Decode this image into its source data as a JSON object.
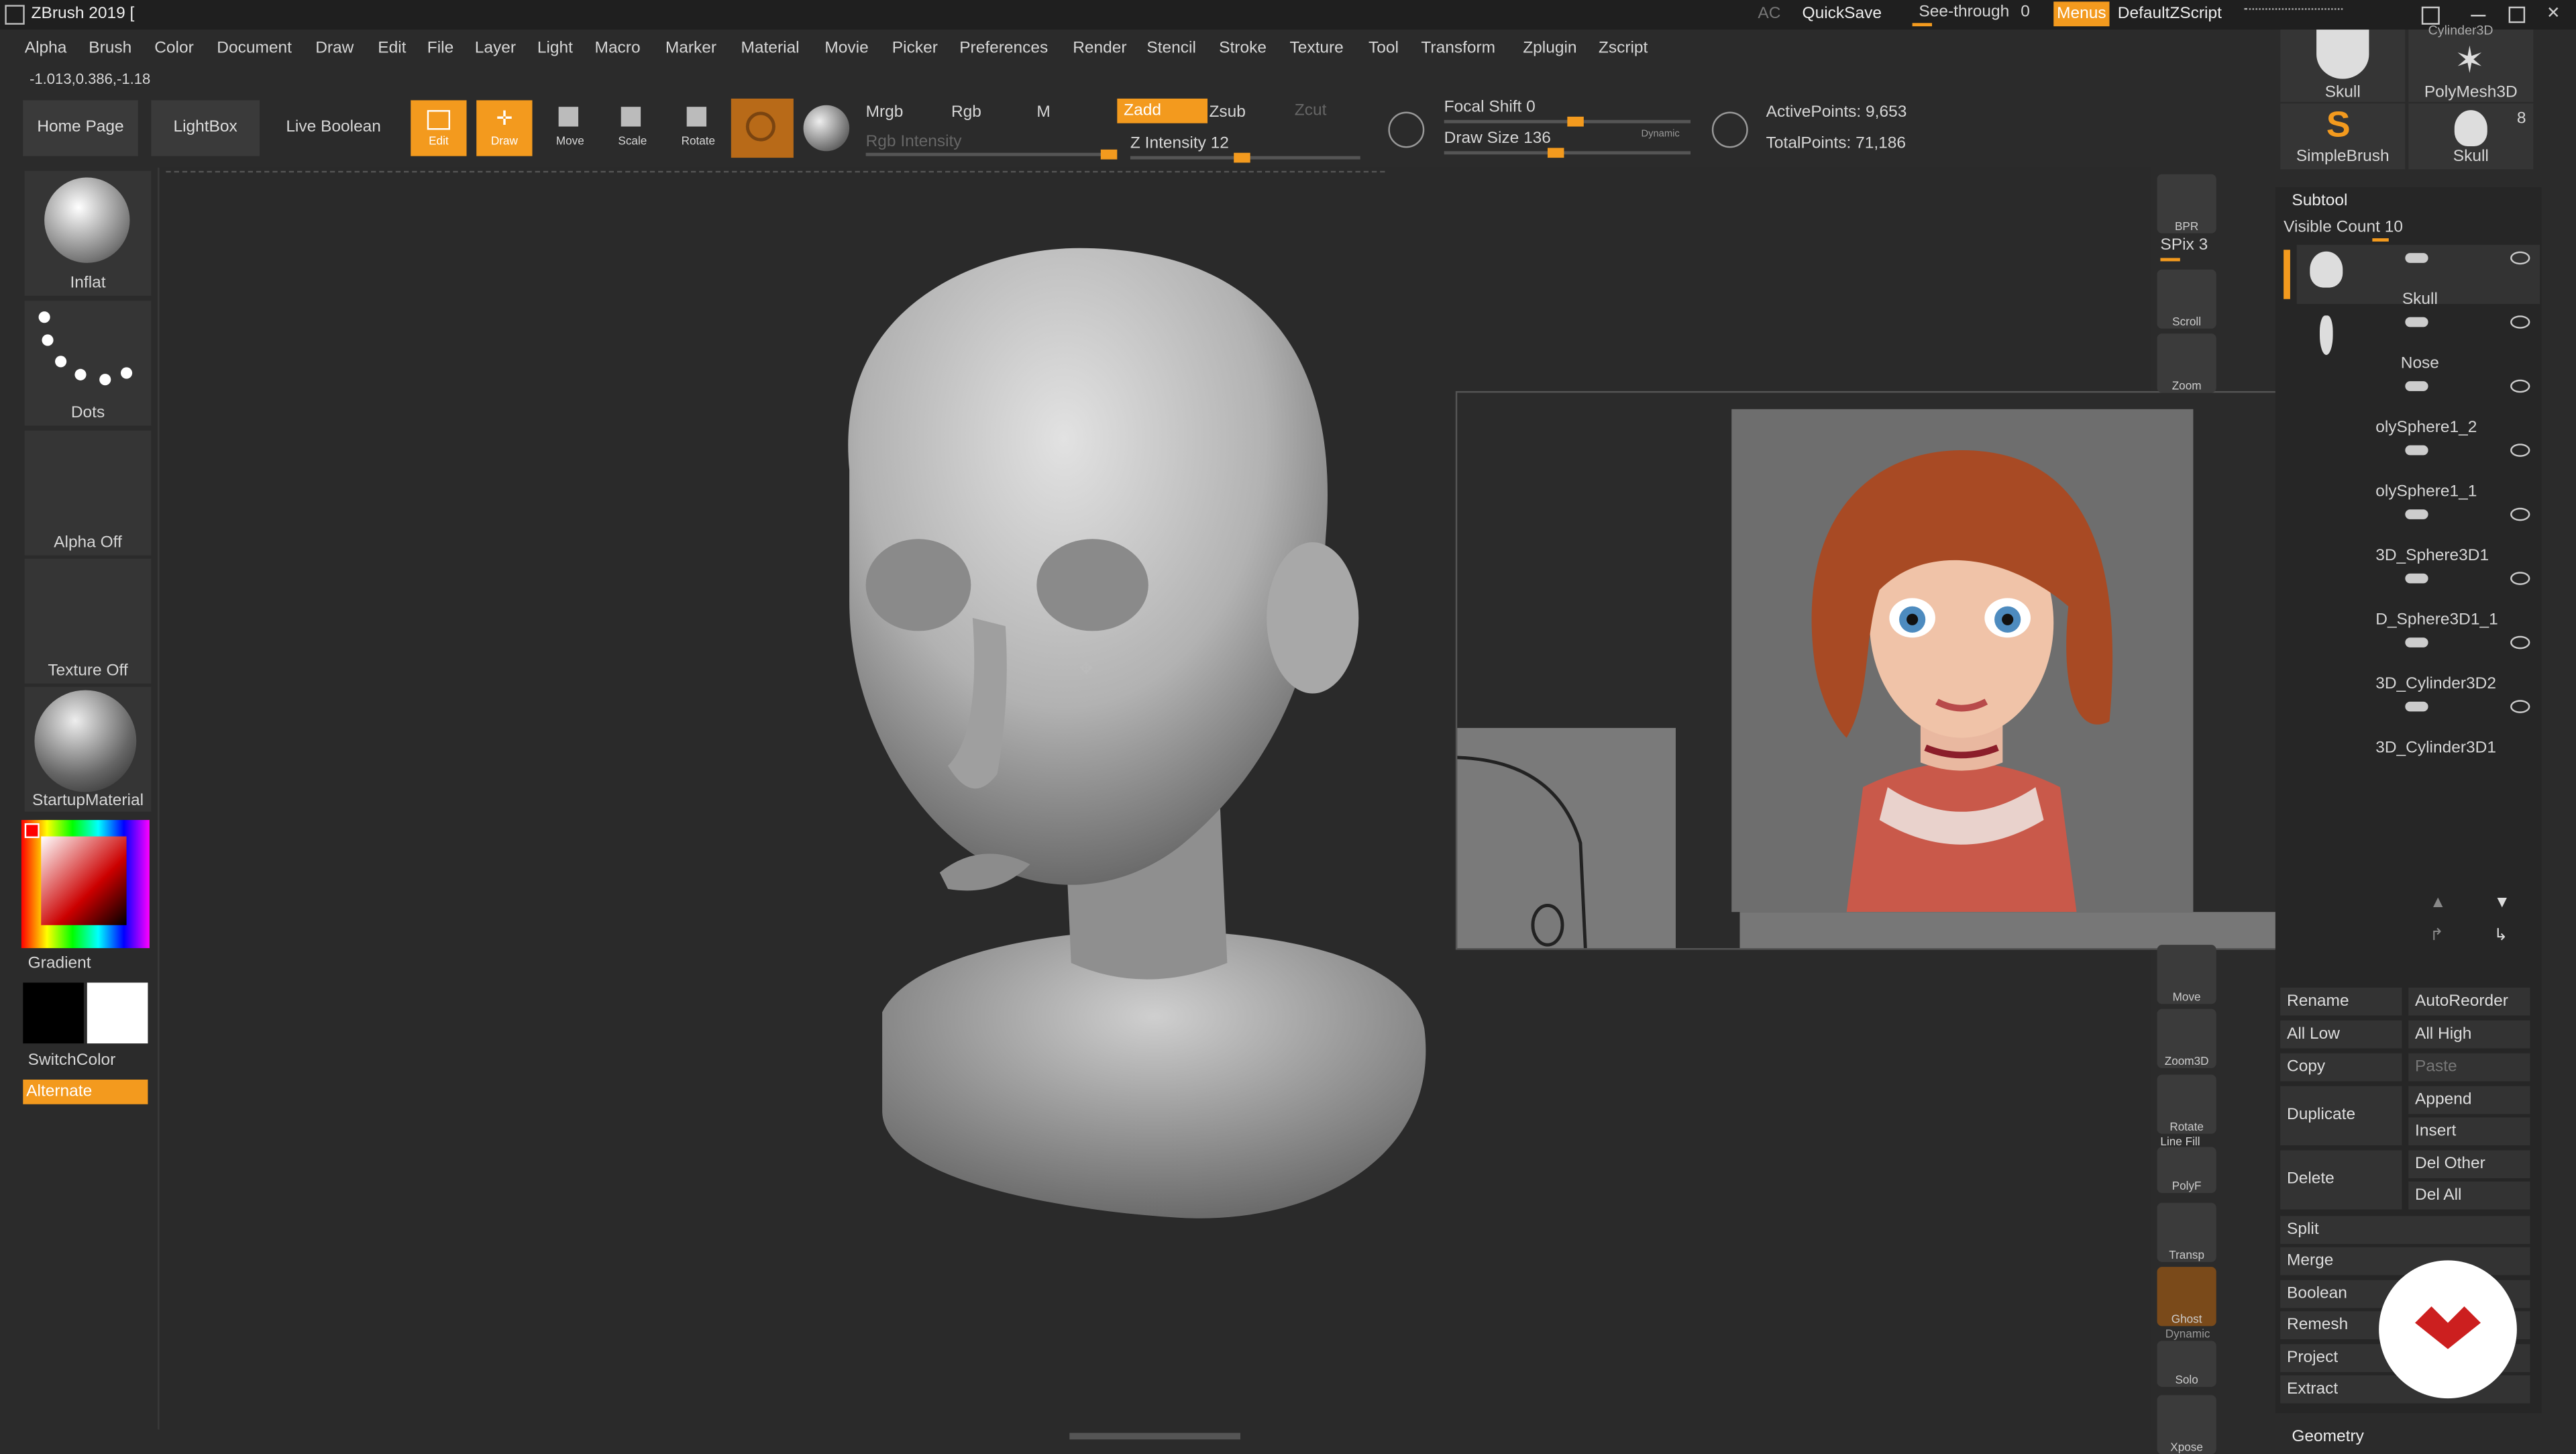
{
  "window": {
    "title": "ZBrush 2019 [",
    "ac": "AC",
    "quicksave": "QuickSave",
    "see_through_label": "See-through",
    "see_through_value": "0",
    "menus": "Menus",
    "script": "DefaultZScript"
  },
  "menubar": [
    "Alpha",
    "Brush",
    "Color",
    "Document",
    "Draw",
    "Edit",
    "File",
    "Layer",
    "Light",
    "Macro",
    "Marker",
    "Material",
    "Movie",
    "Picker",
    "Preferences",
    "Render",
    "Stencil",
    "Stroke",
    "Texture",
    "Tool",
    "Transform",
    "Zplugin",
    "Zscript"
  ],
  "coords": "-1.013,0.386,-1.18",
  "shelf": {
    "home": "Home Page",
    "lightbox": "LightBox",
    "live_boolean": "Live Boolean",
    "edit": "Edit",
    "draw": "Draw",
    "move": "Move",
    "scale": "Scale",
    "rotate": "Rotate",
    "mrgb": "Mrgb",
    "rgb": "Rgb",
    "m": "M",
    "rgb_intensity": "Rgb Intensity",
    "zadd": "Zadd",
    "zsub": "Zsub",
    "zcut": "Zcut",
    "z_intensity": "Z Intensity 12",
    "focal_shift": "Focal Shift 0",
    "draw_size": "Draw Size 136",
    "dynamic": "Dynamic",
    "active_points": "ActivePoints: 9,653",
    "total_points": "TotalPoints: 71,186",
    "focal_fraction": 0.5,
    "drawsize_fraction": 0.42,
    "zint_fraction": 0.45,
    "rgbint_fraction": 0.95
  },
  "left": {
    "brush": "Inflat",
    "stroke": "Dots",
    "alpha": "Alpha Off",
    "texture": "Texture Off",
    "material": "StartupMaterial",
    "gradient": "Gradient",
    "switchcolor": "SwitchColor",
    "alternate": "Alternate"
  },
  "right_shelf": {
    "bpr": "BPR",
    "spix": "SPix 3",
    "scroll": "Scroll",
    "zoom": "Zoom",
    "move": "Move",
    "zoom3d": "Zoom3D",
    "rotate": "Rotate",
    "line_fill": "Line Fill",
    "polyf": "PolyF",
    "transp": "Transp",
    "ghost": "Ghost",
    "dynamic": "Dynamic",
    "solo": "Solo",
    "xpose": "Xpose"
  },
  "tool_palette": {
    "items": [
      "Skull",
      "PolyMesh3D",
      "SimpleBrush",
      "Skull"
    ],
    "top_partial": "Cylinder3D",
    "count_badge": "8"
  },
  "subtool": {
    "title": "Subtool",
    "visible_count": "Visible Count 10",
    "items": [
      "Skull",
      "Nose",
      "olySphere1_2",
      "olySphere1_1",
      "3D_Sphere3D1",
      "D_Sphere3D1_1",
      "3D_Cylinder3D2",
      "3D_Cylinder3D1"
    ],
    "buttons": {
      "rename": "Rename",
      "autoreorder": "AutoReorder",
      "all_low": "All Low",
      "all_high": "All High",
      "copy": "Copy",
      "paste": "Paste",
      "duplicate": "Duplicate",
      "append": "Append",
      "insert": "Insert",
      "delete": "Delete",
      "del_other": "Del Other",
      "del_all": "Del All",
      "split": "Split",
      "merge": "Merge",
      "boolean": "Boolean",
      "remesh": "Remesh",
      "project": "Project",
      "extract": "Extract"
    },
    "geometry": "Geometry"
  },
  "colors": {
    "accent": "#f39a1e",
    "bg": "#2b2b2b",
    "logo": "#cc1f1f"
  }
}
